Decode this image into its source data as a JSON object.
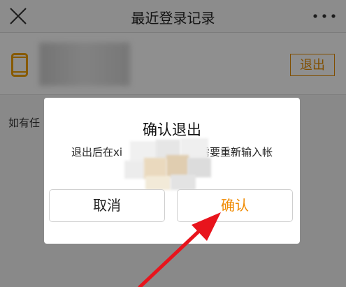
{
  "header": {
    "title": "最近登录记录",
    "close_icon": "close-icon",
    "more_icon": "more-icon"
  },
  "device_row": {
    "icon": "phone-icon",
    "logout_label": "退出"
  },
  "page": {
    "note_text": "如有任"
  },
  "dialog": {
    "title": "确认退出",
    "message_prefix": "退出后在xi",
    "message_suffix": "需要重新输入帐",
    "cancel_label": "取消",
    "confirm_label": "确认"
  },
  "colors": {
    "accent": "#f08a00",
    "annotation_arrow": "#e8141c"
  }
}
